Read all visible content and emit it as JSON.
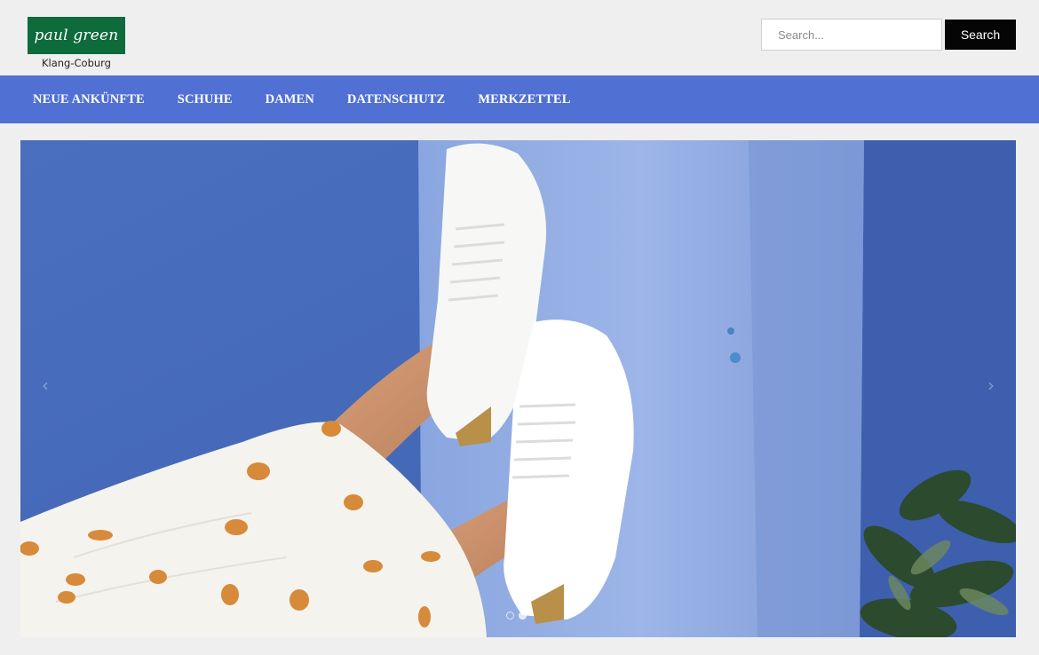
{
  "brand": {
    "logo_text": "paul green",
    "location": "Klang-Coburg",
    "logo_color": "#0e6b3c"
  },
  "search": {
    "placeholder": "Search...",
    "button_label": "Search"
  },
  "nav": {
    "color": "#5170d4",
    "items": [
      {
        "label": "NEUE ANKÜNFTE"
      },
      {
        "label": "SCHUHE"
      },
      {
        "label": "DAMEN"
      },
      {
        "label": "DATENSCHUTZ"
      },
      {
        "label": "MERKZETTEL"
      }
    ]
  },
  "slider": {
    "prev_icon": "‹",
    "next_icon": "›",
    "slide_count": 2,
    "active_slide": 2
  }
}
